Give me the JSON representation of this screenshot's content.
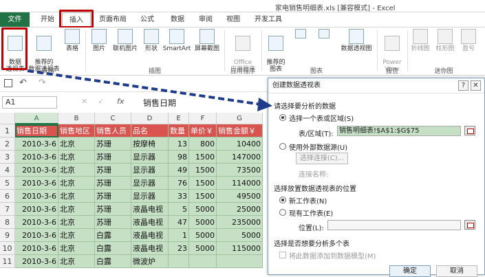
{
  "window": {
    "title": "家电销售明细表.xls  [兼容模式] - Excel"
  },
  "tabs": [
    "文件",
    "开始",
    "插入",
    "页面布局",
    "公式",
    "数据",
    "审阅",
    "视图",
    "开发工具"
  ],
  "ribbon": {
    "buttons": {
      "pivot": "数据\n透视表",
      "recommended_pivot": "推荐的\n数据透视表",
      "table": "表格",
      "pictures": "图片",
      "online_pictures": "联机图片",
      "shapes": "形状",
      "smartart": "SmartArt",
      "screenshot": "屏幕截图",
      "office_apps": "Office\n应用程序",
      "recommended_charts": "推荐的\n图表",
      "pivot_chart": "数据透视图",
      "power_view": "Power\nView",
      "line": "折线图",
      "column": "柱形图",
      "win_loss": "盈亏"
    },
    "groups": {
      "tables": "表格",
      "illustrations": "插图",
      "apps": "应用程序",
      "charts": "图表",
      "reports": "报告",
      "sparklines": "迷你图"
    }
  },
  "formula_bar": {
    "name_box": "A1",
    "fx": "fx",
    "value": "销售日期"
  },
  "sheet": {
    "columns": [
      "A",
      "B",
      "C",
      "D",
      "E",
      "F",
      "G"
    ],
    "rows": [
      "1",
      "2",
      "3",
      "4",
      "5",
      "6",
      "7",
      "8",
      "9",
      "10",
      "11"
    ],
    "header": [
      "销售日期",
      "销售地区",
      "销售人员",
      "品名",
      "数量",
      "单价￥",
      "销售金额￥"
    ],
    "data": [
      [
        "2010-3-6",
        "北京",
        "苏珊",
        "按摩椅",
        "13",
        "800",
        "10400"
      ],
      [
        "2010-3-6",
        "北京",
        "苏珊",
        "显示器",
        "98",
        "1500",
        "147000"
      ],
      [
        "2010-3-6",
        "北京",
        "苏珊",
        "显示器",
        "49",
        "1500",
        "73500"
      ],
      [
        "2010-3-6",
        "北京",
        "苏珊",
        "显示器",
        "76",
        "1500",
        "114000"
      ],
      [
        "2010-3-6",
        "北京",
        "苏珊",
        "显示器",
        "33",
        "1500",
        "49500"
      ],
      [
        "2010-3-6",
        "北京",
        "苏珊",
        "液晶电视",
        "5",
        "5000",
        "25000"
      ],
      [
        "2010-3-6",
        "北京",
        "苏珊",
        "液晶电视",
        "47",
        "5000",
        "235000"
      ],
      [
        "2010-3-6",
        "北京",
        "白露",
        "液晶电视",
        "1",
        "5000",
        "5000"
      ],
      [
        "2010-3-6",
        "北京",
        "白露",
        "液晶电视",
        "23",
        "5000",
        "115000"
      ],
      [
        "2010-3-6",
        "北京",
        "白露",
        "微波炉",
        "",
        "",
        ""
      ]
    ]
  },
  "dialog": {
    "title": "创建数据透视表",
    "help": "?",
    "close": "✕",
    "section1": "请选择要分析的数据",
    "opt_range": "选择一个表或区域(S)",
    "range_label": "表/区域(T):",
    "range_value": "销售明细表!$A$1:$G$75",
    "opt_external": "使用外部数据源(U)",
    "choose_conn": "选择连接(C)...",
    "conn_name": "连接名称:",
    "section2": "选择放置数据透视表的位置",
    "opt_new_sheet": "新工作表(N)",
    "opt_existing": "现有工作表(E)",
    "location_label": "位置(L):",
    "section3": "选择是否想要分析多个表",
    "add_model": "将此数据添加到数据模型(M)",
    "ok": "确定",
    "cancel": "取消"
  }
}
